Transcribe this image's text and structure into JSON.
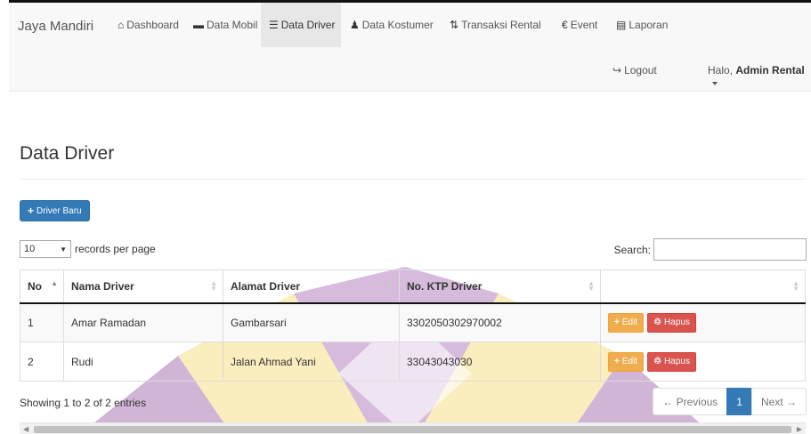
{
  "nav": {
    "brand": "Jaya Mandiri",
    "items": [
      {
        "icon": "home-icon",
        "glyph": "⌂",
        "label": "Dashboard"
      },
      {
        "icon": "folder-icon",
        "glyph": "▬",
        "label": "Data Mobil"
      },
      {
        "icon": "list-icon",
        "glyph": "☰",
        "label": "Data Driver"
      },
      {
        "icon": "user-icon",
        "glyph": "♟",
        "label": "Data Kostumer"
      },
      {
        "icon": "sort-arrows-icon",
        "glyph": "⇅",
        "label": "Transaksi Rental"
      },
      {
        "icon": "euro-icon",
        "glyph": "€",
        "label": "Event"
      },
      {
        "icon": "report-icon",
        "glyph": "▤",
        "label": "Laporan"
      }
    ],
    "logout_label": "Logout",
    "logout_icon": "↪",
    "greeting": "Halo,",
    "user_name": "Admin Rental"
  },
  "page": {
    "title": "Data Driver",
    "new_button_icon": "+",
    "new_button_label": "Driver Baru",
    "length_value": "10",
    "length_arrow": "▼",
    "length_text": "records per page",
    "search_label": "Search:",
    "search_value": ""
  },
  "table": {
    "columns": [
      "No",
      "Nama Driver",
      "Alamat Driver",
      "No. KTP Driver",
      ""
    ],
    "rows": [
      {
        "no": "1",
        "nama": "Amar Ramadan",
        "alamat": "Gambarsari",
        "ktp": "3302050302970002"
      },
      {
        "no": "2",
        "nama": "Rudi",
        "alamat": "Jalan Ahmad Yani",
        "ktp": "33043043030"
      }
    ],
    "edit_icon": "+",
    "edit_label": "Edit",
    "delete_icon": "♲",
    "delete_label": "Hapus"
  },
  "footer": {
    "info": "Showing 1 to 2 of 2 entries",
    "prev": "← Previous",
    "current_page": "1",
    "next": "Next →"
  },
  "colors": {
    "primary": "#337ab7",
    "warning": "#f0ad4e",
    "danger": "#d9534f",
    "watermark_yellow": "#f5d76e",
    "watermark_purple": "#8a3c9a"
  }
}
